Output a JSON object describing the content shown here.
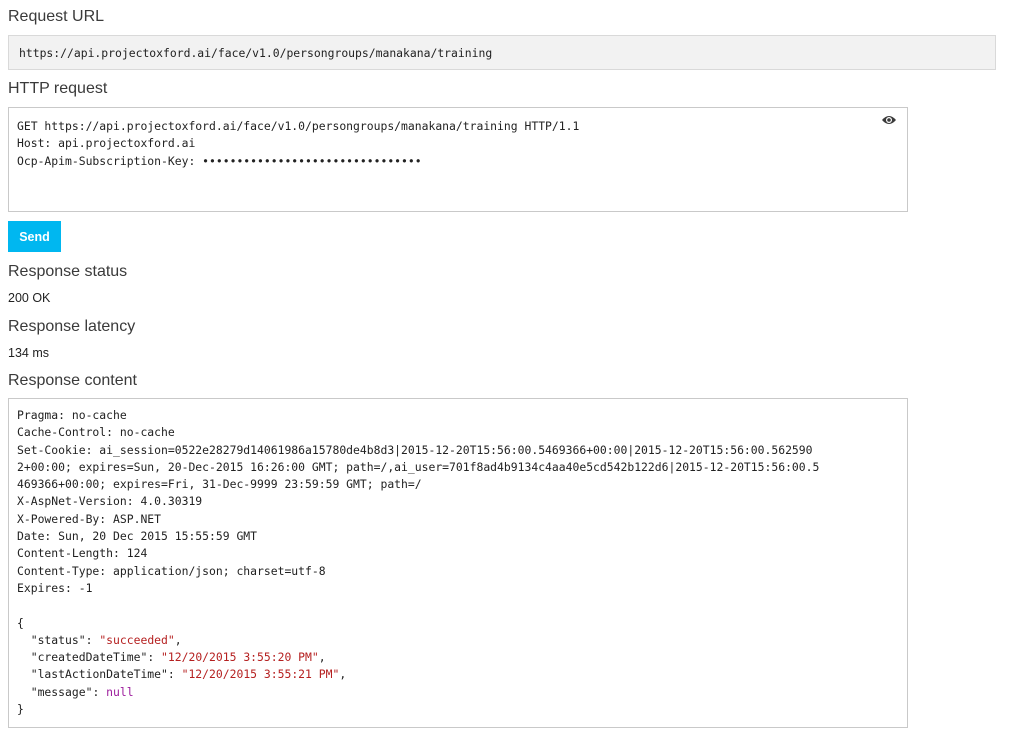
{
  "request_url": {
    "label": "Request URL",
    "value": "https://api.projectoxford.ai/face/v1.0/persongroups/manakana/training"
  },
  "http_request": {
    "label": "HTTP request",
    "lines": [
      "GET https://api.projectoxford.ai/face/v1.0/persongroups/manakana/training HTTP/1.1",
      "Host: api.projectoxford.ai",
      "Ocp-Apim-Subscription-Key: ••••••••••••••••••••••••••••••••"
    ],
    "reveal_icon": "eye-icon"
  },
  "send_button": {
    "label": "Send"
  },
  "response_status": {
    "label": "Response status",
    "value": "200 OK"
  },
  "response_latency": {
    "label": "Response latency",
    "value": "134 ms"
  },
  "response_content": {
    "label": "Response content",
    "headers": [
      "Pragma: no-cache",
      "Cache-Control: no-cache",
      "Set-Cookie: ai_session=0522e28279d14061986a15780de4b8d3|2015-12-20T15:56:00.5469366+00:00|2015-12-20T15:56:00.562590",
      "2+00:00; expires=Sun, 20-Dec-2015 16:26:00 GMT; path=/,ai_user=701f8ad4b9134c4aa40e5cd542b122d6|2015-12-20T15:56:00.5",
      "469366+00:00; expires=Fri, 31-Dec-9999 23:59:59 GMT; path=/",
      "X-AspNet-Version: 4.0.30319",
      "X-Powered-By: ASP.NET",
      "Date: Sun, 20 Dec 2015 15:55:59 GMT",
      "Content-Length: 124",
      "Content-Type: application/json; charset=utf-8",
      "Expires: -1"
    ],
    "json_open": "{",
    "json_close": "}",
    "json_fields": [
      {
        "key": "\"status\"",
        "value": "\"succeeded\"",
        "type": "string",
        "trail": ","
      },
      {
        "key": "\"createdDateTime\"",
        "value": "\"12/20/2015 3:55:20 PM\"",
        "type": "string",
        "trail": ","
      },
      {
        "key": "\"lastActionDateTime\"",
        "value": "\"12/20/2015 3:55:21 PM\"",
        "type": "string",
        "trail": ","
      },
      {
        "key": "\"message\"",
        "value": "null",
        "type": "null",
        "trail": ""
      }
    ]
  },
  "colors": {
    "send_button": "#00b7f0",
    "json_string": "#b52020",
    "json_null": "#9c1c9c"
  }
}
